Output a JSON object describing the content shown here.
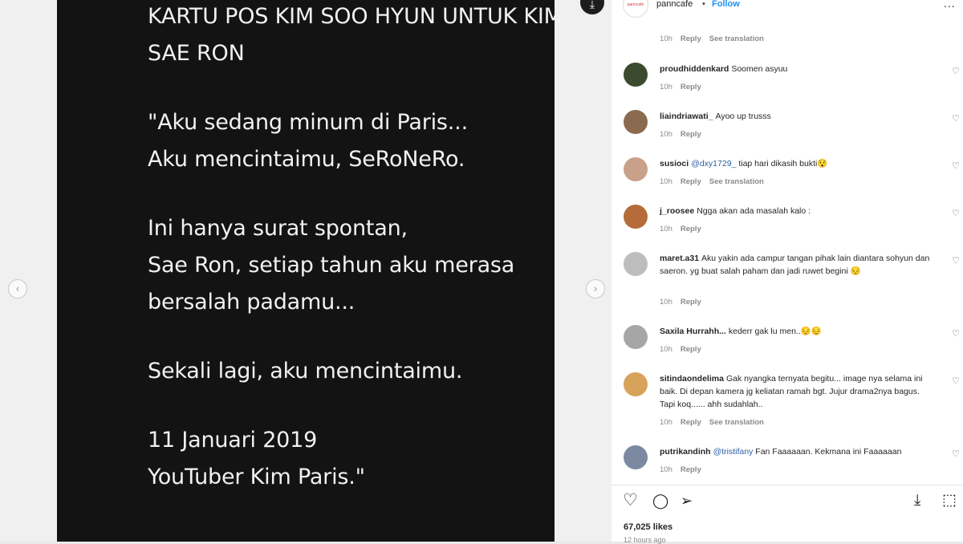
{
  "post_text": {
    "lines": [
      [
        "KARTU POS KIM SOO HYUN UNTUK KIM",
        "SAE RON"
      ],
      [
        "\"Aku sedang minum di Paris...",
        "Aku mencintaimu, SeRoNeRo."
      ],
      [
        "Ini hanya surat spontan,",
        "Sae Ron, setiap tahun aku merasa",
        "bersalah padamu..."
      ],
      [
        "Sekali lagi, aku mencintaimu."
      ],
      [
        "11 Januari 2019",
        "YouTuber Kim Paris.\""
      ]
    ]
  },
  "nav": {
    "prev_icon": "‹",
    "next_icon": "›"
  },
  "header": {
    "username": "panncafe",
    "dot": "•",
    "follow": "Follow",
    "avatar_text": "panncafe",
    "download_icon": "download-icon",
    "more": "..."
  },
  "comments": [
    {
      "user": "",
      "text": "",
      "time": "10h",
      "reply": "Reply",
      "translate": "See translation",
      "avatar_color": "#9aa3a8"
    },
    {
      "user": "proudhiddenkard",
      "text": "Soomen asyuu",
      "time": "10h",
      "reply": "Reply",
      "translate": "",
      "avatar_color": "#3c4a2e"
    },
    {
      "user": "liaindriawati_",
      "text": "Ayoo up trusss",
      "time": "10h",
      "reply": "Reply",
      "translate": "",
      "avatar_color": "#8a6b4f"
    },
    {
      "user": "susioci",
      "mention": "@dxy1729_",
      "text": "tiap hari dikasih bukti😯",
      "time": "10h",
      "reply": "Reply",
      "translate": "See translation",
      "avatar_color": "#c9a08a"
    },
    {
      "user": "j_roosee",
      "text": "Ngga akan ada masalah kalo :",
      "time": "10h",
      "reply": "Reply",
      "translate": "",
      "avatar_color": "#b56c3a"
    },
    {
      "user": "maret.a31",
      "text": "Aku yakin ada campur tangan pihak lain diantara sohyun dan saeron. yg buat salah paham dan jadi ruwet begini 😔",
      "time": "10h",
      "reply": "Reply",
      "translate": "",
      "avatar_color": "#bdbdbd"
    },
    {
      "user": "Saxila Hurrahh...",
      "text": "kederr gak lu men..😔😔",
      "time": "10h",
      "reply": "Reply",
      "translate": "",
      "avatar_color": "#a6a6a6"
    },
    {
      "user": "sitindaondelima",
      "text": "Gak nyangka ternyata begitu... image nya selama ini baik. Di depan kamera jg keliatan ramah bgt. Jujur drama2nya bagus. Tapi koq...... ahh sudahlah..",
      "time": "10h",
      "reply": "Reply",
      "translate": "See translation",
      "avatar_color": "#d7a35a"
    },
    {
      "user": "putrikandinh",
      "mention": "@tristifany",
      "text": "Fan Faaaaaan. Kekmana ini Faaaaaan",
      "time": "10h",
      "reply": "Reply",
      "translate": "",
      "avatar_color": "#7b8aa0"
    }
  ],
  "heart_small": "♡",
  "actions": {
    "like": "♡",
    "comment": "◯",
    "share": "➢",
    "save": "⬚"
  },
  "likes": "67,025 likes",
  "time_ago": "12 hours ago"
}
